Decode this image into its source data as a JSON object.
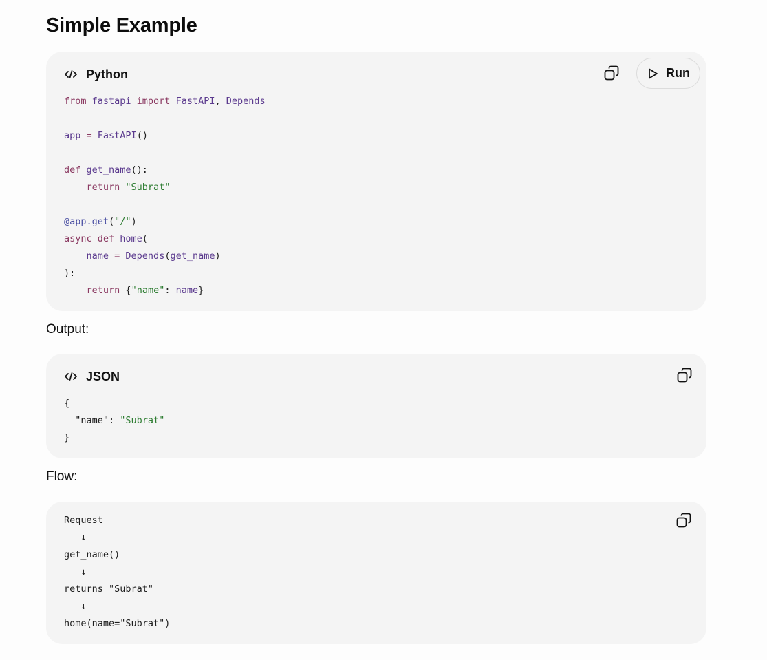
{
  "heading": "Simple Example",
  "python_block": {
    "language": "Python",
    "run_label": "Run",
    "icons": {
      "lang": "code-icon",
      "copy": "copy-icon",
      "run": "play-icon"
    },
    "lines": [
      [
        {
          "t": "from ",
          "c": "kw"
        },
        {
          "t": "fastapi ",
          "c": "fn"
        },
        {
          "t": "import ",
          "c": "kw"
        },
        {
          "t": "FastAPI",
          "c": "fn"
        },
        {
          "t": ", ",
          "c": "pl"
        },
        {
          "t": "Depends",
          "c": "fn"
        }
      ],
      [],
      [
        {
          "t": "app ",
          "c": "fn"
        },
        {
          "t": "= ",
          "c": "kw"
        },
        {
          "t": "FastAPI",
          "c": "fn"
        },
        {
          "t": "()",
          "c": "pl"
        }
      ],
      [],
      [
        {
          "t": "def ",
          "c": "kw"
        },
        {
          "t": "get_name",
          "c": "fn"
        },
        {
          "t": "():",
          "c": "pl"
        }
      ],
      [
        {
          "t": "    ",
          "c": "pl"
        },
        {
          "t": "return ",
          "c": "kw"
        },
        {
          "t": "\"Subrat\"",
          "c": "str"
        }
      ],
      [],
      [
        {
          "t": "@app.get",
          "c": "dec"
        },
        {
          "t": "(",
          "c": "pl"
        },
        {
          "t": "\"/\"",
          "c": "str"
        },
        {
          "t": ")",
          "c": "pl"
        }
      ],
      [
        {
          "t": "async def ",
          "c": "kw"
        },
        {
          "t": "home",
          "c": "fn"
        },
        {
          "t": "(",
          "c": "pl"
        }
      ],
      [
        {
          "t": "    ",
          "c": "pl"
        },
        {
          "t": "name ",
          "c": "fn"
        },
        {
          "t": "= ",
          "c": "kw"
        },
        {
          "t": "Depends",
          "c": "fn"
        },
        {
          "t": "(",
          "c": "pl"
        },
        {
          "t": "get_name",
          "c": "fn"
        },
        {
          "t": ")",
          "c": "pl"
        }
      ],
      [
        {
          "t": "):",
          "c": "pl"
        }
      ],
      [
        {
          "t": "    ",
          "c": "pl"
        },
        {
          "t": "return ",
          "c": "kw"
        },
        {
          "t": "{",
          "c": "pl"
        },
        {
          "t": "\"name\"",
          "c": "str"
        },
        {
          "t": ": ",
          "c": "pl"
        },
        {
          "t": "name",
          "c": "fn"
        },
        {
          "t": "}",
          "c": "pl"
        }
      ]
    ]
  },
  "output_caption": "Output:",
  "json_block": {
    "language": "JSON",
    "icons": {
      "lang": "code-icon",
      "copy": "copy-icon"
    },
    "lines": [
      [
        {
          "t": "{",
          "c": "pl"
        }
      ],
      [
        {
          "t": "  \"name\"",
          "c": "pl"
        },
        {
          "t": ": ",
          "c": "pl"
        },
        {
          "t": "\"Subrat\"",
          "c": "str"
        }
      ],
      [
        {
          "t": "}",
          "c": "pl"
        }
      ]
    ]
  },
  "flow_caption": "Flow:",
  "flow_block": {
    "icons": {
      "copy": "copy-icon"
    },
    "lines": [
      [
        {
          "t": "Request",
          "c": "pl"
        }
      ],
      [
        {
          "t": "   ↓",
          "c": "pl"
        }
      ],
      [
        {
          "t": "get_name()",
          "c": "pl"
        }
      ],
      [
        {
          "t": "   ↓",
          "c": "pl"
        }
      ],
      [
        {
          "t": "returns \"Subrat\"",
          "c": "pl"
        }
      ],
      [
        {
          "t": "   ↓",
          "c": "pl"
        }
      ],
      [
        {
          "t": "home(name=\"Subrat\")",
          "c": "pl"
        }
      ]
    ]
  },
  "colors": {
    "keyword": "#8b3a62",
    "function": "#5b3a8e",
    "string": "#2e7d32",
    "decorator": "#4a4fa3",
    "block_background": "#f4f4f4"
  }
}
